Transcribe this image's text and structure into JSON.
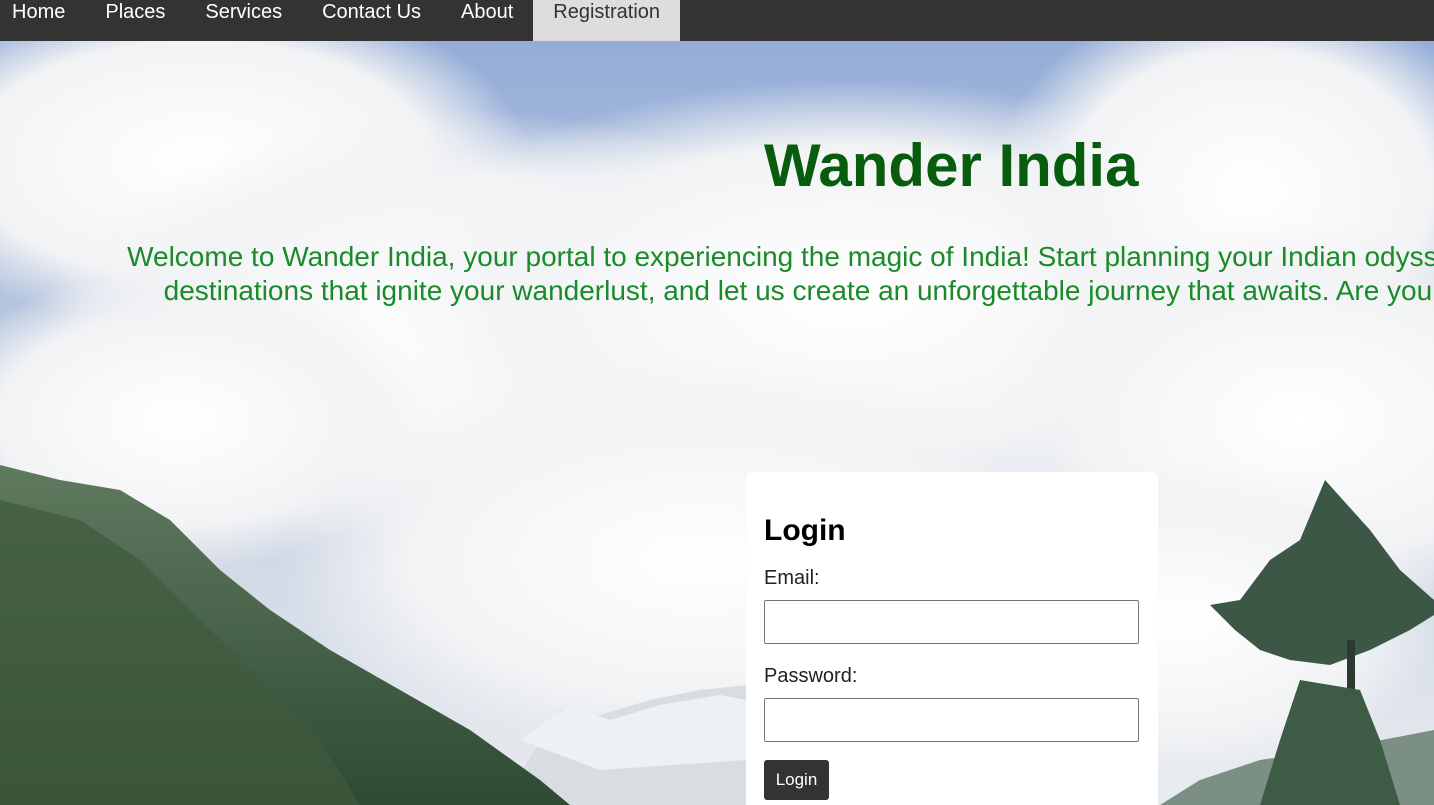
{
  "nav": {
    "items": [
      {
        "label": "Home",
        "active": false
      },
      {
        "label": "Places",
        "active": false
      },
      {
        "label": "Services",
        "active": false
      },
      {
        "label": "Contact Us",
        "active": false
      },
      {
        "label": "About",
        "active": false
      },
      {
        "label": "Registration",
        "active": true
      }
    ]
  },
  "hero": {
    "title": "Wander India",
    "welcome_text": "Welcome to Wander India, your portal to experiencing the magic of India! Start planning your Indian odyssey on our website, discover destinations that ignite your wanderlust, and let us create an unforgettable journey that awaits. Are you ready to answer its call?"
  },
  "login": {
    "heading": "Login",
    "email_label": "Email:",
    "email_value": "",
    "password_label": "Password:",
    "password_value": "",
    "submit_label": "Login"
  },
  "colors": {
    "nav_bg": "#333333",
    "nav_active_bg": "#dddddd",
    "title": "#075c0d",
    "welcome_text": "#1b8a2b"
  }
}
